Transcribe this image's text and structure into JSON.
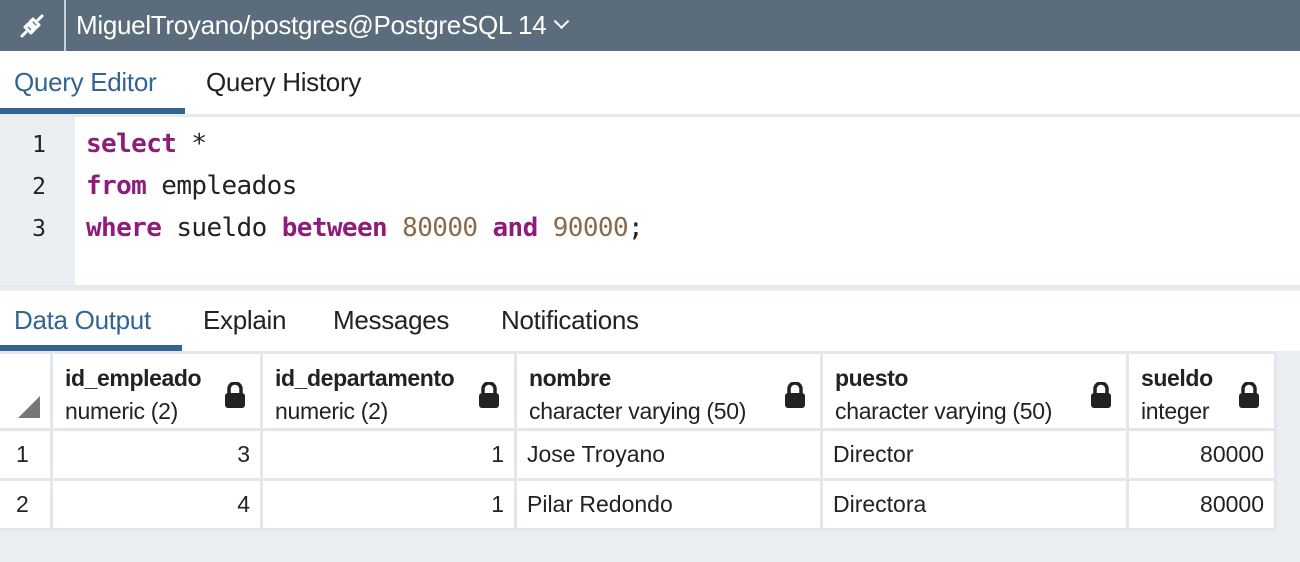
{
  "header": {
    "connection_icon": "plug-connected-icon",
    "connection_title": "MiguelTroyano/postgres@PostgreSQL 14",
    "dropdown_icon": "chevron-down-icon"
  },
  "editor_tabs": [
    {
      "label": "Query Editor",
      "active": true
    },
    {
      "label": "Query History",
      "active": false
    }
  ],
  "editor": {
    "line_numbers": [
      "1",
      "2",
      "3"
    ],
    "lines": [
      [
        {
          "t": "select",
          "c": "kw"
        },
        {
          "t": " *",
          "c": ""
        }
      ],
      [
        {
          "t": "from",
          "c": "kw"
        },
        {
          "t": " empleados",
          "c": ""
        }
      ],
      [
        {
          "t": "where",
          "c": "kw"
        },
        {
          "t": " sueldo ",
          "c": ""
        },
        {
          "t": "between",
          "c": "kw"
        },
        {
          "t": " ",
          "c": ""
        },
        {
          "t": "80000",
          "c": "num"
        },
        {
          "t": " ",
          "c": ""
        },
        {
          "t": "and",
          "c": "kw"
        },
        {
          "t": " ",
          "c": ""
        },
        {
          "t": "90000",
          "c": "num"
        },
        {
          "t": ";",
          "c": ""
        }
      ]
    ]
  },
  "output_tabs": [
    {
      "label": "Data Output",
      "active": true
    },
    {
      "label": "Explain",
      "active": false
    },
    {
      "label": "Messages",
      "active": false
    },
    {
      "label": "Notifications",
      "active": false
    }
  ],
  "table": {
    "columns": [
      {
        "name": "id_empleado",
        "type": "numeric (2)",
        "icon": "lock-icon",
        "align": "right"
      },
      {
        "name": "id_departamento",
        "type": "numeric (2)",
        "icon": "lock-icon",
        "align": "right"
      },
      {
        "name": "nombre",
        "type": "character varying (50)",
        "icon": "lock-icon",
        "align": "left"
      },
      {
        "name": "puesto",
        "type": "character varying (50)",
        "icon": "lock-icon",
        "align": "left"
      },
      {
        "name": "sueldo",
        "type": "integer",
        "icon": "lock-icon",
        "align": "right"
      }
    ],
    "rows": [
      {
        "num": "1",
        "cells": [
          "3",
          "1",
          "Jose Troyano",
          "Director",
          "80000"
        ]
      },
      {
        "num": "2",
        "cells": [
          "4",
          "1",
          "Pilar Redondo",
          "Directora",
          "80000"
        ]
      }
    ]
  },
  "colors": {
    "accent": "#326690",
    "header_bg": "#5b6d7c",
    "keyword": "#8e1c7a",
    "number": "#8c6a4d"
  }
}
